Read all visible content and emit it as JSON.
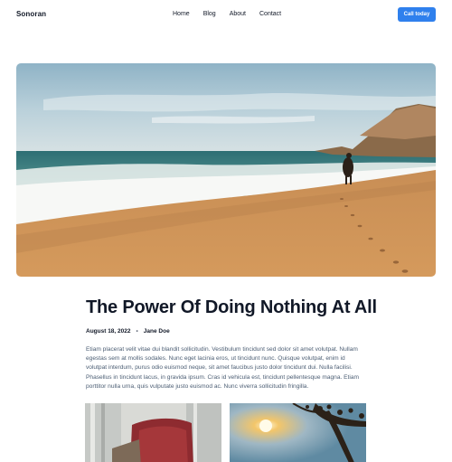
{
  "header": {
    "logo": "Sonoran",
    "nav": [
      "Home",
      "Blog",
      "About",
      "Contact"
    ],
    "cta": "Call today"
  },
  "article": {
    "title": "The Power Of Doing Nothing At All",
    "date": "August 18, 2022",
    "separator": "•",
    "author": "Jane Doe",
    "body": "Etiam placerat velit vitae dui blandit sollicitudin. Vestibulum tincidunt sed dolor sit amet volutpat. Nullam egestas sem at mollis sodales. Nunc eget lacinia eros, ut tincidunt nunc. Quisque volutpat, enim id volutpat interdum, purus odio euismod neque, sit amet faucibus justo dolor tincidunt dui. Nulla facilisi. Phasellus in tincidunt lacus, in gravida ipsum. Cras id vehicula est, tincidunt pellentesque magna. Etiam porttitor nulla urna, quis vulputate justo euismod ac. Nunc viverra sollicitudin fringilla."
  },
  "colors": {
    "accent": "#2f80ed",
    "text": "#111827",
    "muted": "#4b5d73"
  }
}
